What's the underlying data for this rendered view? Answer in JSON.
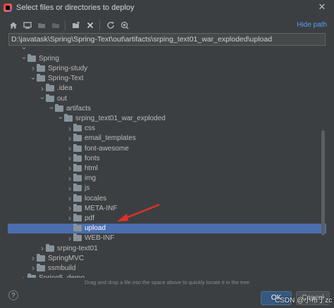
{
  "window": {
    "title": "Select files or directories to deploy",
    "close_glyph": "✕",
    "app_icon": "intellij-icon"
  },
  "toolbar": {
    "buttons": [
      {
        "icon": "home-icon"
      },
      {
        "icon": "desktop-icon"
      },
      {
        "icon": "project-icon"
      },
      {
        "icon": "module-icon"
      },
      {
        "icon": "new-folder-icon"
      },
      {
        "icon": "delete-icon"
      },
      {
        "icon": "refresh-icon"
      },
      {
        "icon": "show-hidden-icon"
      }
    ],
    "hide_path": "Hide path"
  },
  "path": {
    "value": "D:\\javatask\\Spring\\Spring-Text\\out\\artifacts\\srping_text01_war_exploded\\upload"
  },
  "tree": {
    "rows": [
      {
        "label": "",
        "level": 2,
        "expanded": true,
        "partial": true
      },
      {
        "label": "Spring",
        "level": 2,
        "expanded": true
      },
      {
        "label": "Spring-study",
        "level": 3,
        "expanded": false
      },
      {
        "label": "Spring-Text",
        "level": 3,
        "expanded": true
      },
      {
        "label": ".idea",
        "level": 4,
        "expanded": false
      },
      {
        "label": "out",
        "level": 4,
        "expanded": true
      },
      {
        "label": "artifacts",
        "level": 5,
        "expanded": true
      },
      {
        "label": "srping_text01_war_exploded",
        "level": 6,
        "expanded": true
      },
      {
        "label": "css",
        "level": 7,
        "expanded": false
      },
      {
        "label": "email_templates",
        "level": 7,
        "expanded": false
      },
      {
        "label": "font-awesome",
        "level": 7,
        "expanded": false
      },
      {
        "label": "fonts",
        "level": 7,
        "expanded": false
      },
      {
        "label": "html",
        "level": 7,
        "expanded": false
      },
      {
        "label": "img",
        "level": 7,
        "expanded": false
      },
      {
        "label": "js",
        "level": 7,
        "expanded": false
      },
      {
        "label": "locales",
        "level": 7,
        "expanded": false
      },
      {
        "label": "META-INF",
        "level": 7,
        "expanded": false
      },
      {
        "label": "pdf",
        "level": 7,
        "expanded": false
      },
      {
        "label": "upload",
        "level": 7,
        "expanded": null,
        "selected": true
      },
      {
        "label": "WEB-INF",
        "level": 7,
        "expanded": false
      },
      {
        "label": "srping-text01",
        "level": 4,
        "expanded": false
      },
      {
        "label": "SpringMVC",
        "level": 3,
        "expanded": false
      },
      {
        "label": "ssmbuild",
        "level": 3,
        "expanded": false
      },
      {
        "label": "Spring5_demo",
        "level": 2,
        "expanded": false
      }
    ]
  },
  "footer": {
    "drop_hint": "Drag and drop a file into the space above to quickly locate it in the tree",
    "help_label": "?",
    "ok_label": "OK",
    "cancel_label": "Cancel",
    "watermark": "CSDN @小布丁zc"
  },
  "colors": {
    "background": "#3c3f41",
    "selection": "#4b6eaf",
    "link": "#589df6",
    "annotation_arrow": "#e0302a"
  }
}
